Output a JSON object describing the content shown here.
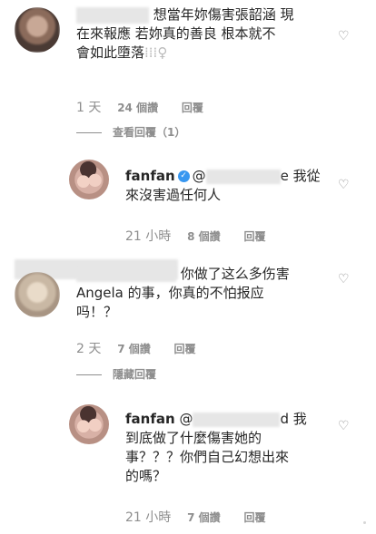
{
  "comments": [
    {
      "text_line1": "想當年妳傷害張韶涵 現",
      "text_line2": "在來報應 若妳真的善良 根本就不",
      "text_line3": "會如此墮落",
      "text_emoji": "♀",
      "time": "1 天",
      "likes": "24 個讚",
      "reply": "回覆",
      "view_replies": "查看回覆（1）"
    },
    {
      "username": "fanfan",
      "mention": "@",
      "mention_end": "e 我從",
      "text_line2": "來沒害過任何人",
      "time": "21 小時",
      "likes": "8 個讚",
      "reply": "回覆"
    },
    {
      "text_line1": "你做了这么多伤害",
      "text_line2": "Angela 的事，你真的不怕报应",
      "text_line3": "吗！？",
      "time": "2 天",
      "likes": "7 個讚",
      "reply": "回覆",
      "hide_replies": "隱藏回覆"
    },
    {
      "username": "fanfan",
      "mention": "@",
      "mention_end": "d 我",
      "text_line2": "到底做了什麼傷害她的",
      "text_line3": "事？？？你們自己幻想出來",
      "text_line4": "的嗎？",
      "time": "21 小時",
      "likes": "7 個讚",
      "reply": "回覆"
    }
  ],
  "icons": {
    "heart": "heart-icon",
    "verified": "verified-badge-icon"
  },
  "colors": {
    "meta_gray": "#8e8e8e",
    "verified_blue": "#3897f0",
    "text": "#262626"
  }
}
